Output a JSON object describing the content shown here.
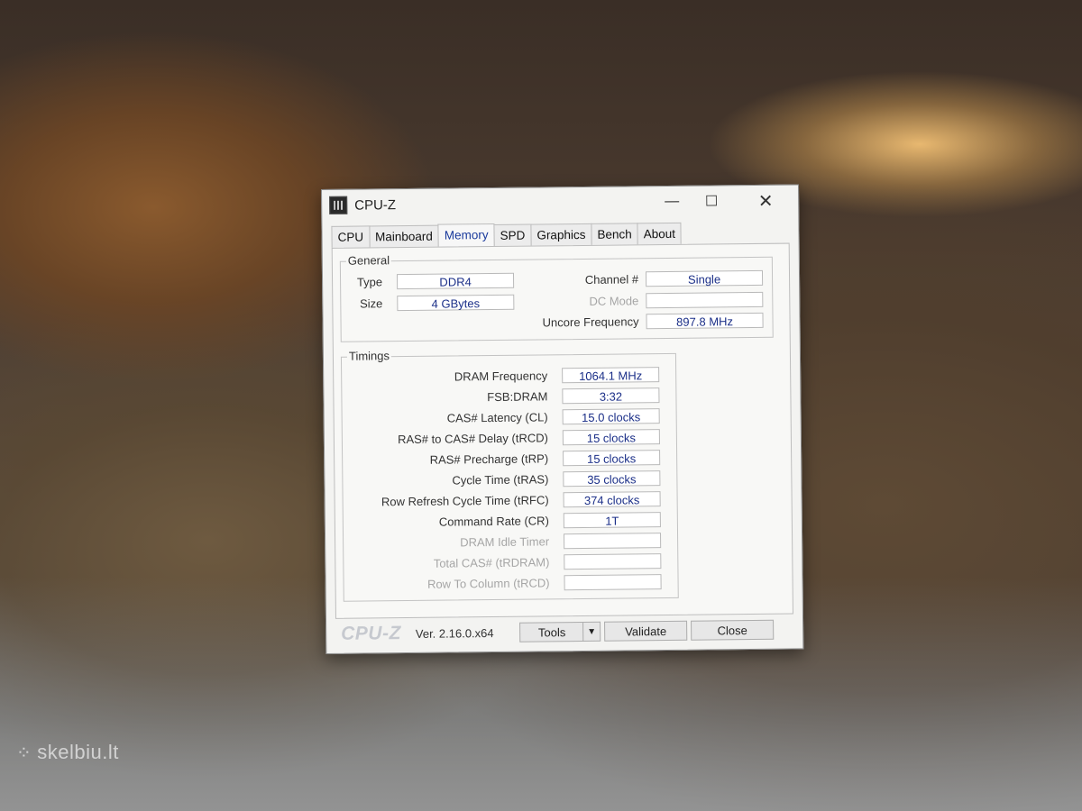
{
  "window": {
    "title": "CPU-Z"
  },
  "tabs": [
    {
      "label": "CPU",
      "active": false
    },
    {
      "label": "Mainboard",
      "active": false
    },
    {
      "label": "Memory",
      "active": true
    },
    {
      "label": "SPD",
      "active": false
    },
    {
      "label": "Graphics",
      "active": false
    },
    {
      "label": "Bench",
      "active": false
    },
    {
      "label": "About",
      "active": false
    }
  ],
  "general": {
    "title": "General",
    "type_label": "Type",
    "type_value": "DDR4",
    "size_label": "Size",
    "size_value": "4 GBytes",
    "channel_label": "Channel #",
    "channel_value": "Single",
    "dc_mode_label": "DC Mode",
    "dc_mode_value": "",
    "uncore_label": "Uncore Frequency",
    "uncore_value": "897.8 MHz"
  },
  "timings": {
    "title": "Timings",
    "rows": [
      {
        "label": "DRAM Frequency",
        "value": "1064.1 MHz",
        "dim": false
      },
      {
        "label": "FSB:DRAM",
        "value": "3:32",
        "dim": false
      },
      {
        "label": "CAS# Latency (CL)",
        "value": "15.0 clocks",
        "dim": false
      },
      {
        "label": "RAS# to CAS# Delay (tRCD)",
        "value": "15 clocks",
        "dim": false
      },
      {
        "label": "RAS# Precharge (tRP)",
        "value": "15 clocks",
        "dim": false
      },
      {
        "label": "Cycle Time (tRAS)",
        "value": "35 clocks",
        "dim": false
      },
      {
        "label": "Row Refresh Cycle Time (tRFC)",
        "value": "374 clocks",
        "dim": false
      },
      {
        "label": "Command Rate (CR)",
        "value": "1T",
        "dim": false
      },
      {
        "label": "DRAM Idle Timer",
        "value": "",
        "dim": true
      },
      {
        "label": "Total CAS# (tRDRAM)",
        "value": "",
        "dim": true
      },
      {
        "label": "Row To Column (tRCD)",
        "value": "",
        "dim": true
      }
    ]
  },
  "footer": {
    "brand": "CPU-Z",
    "version": "Ver. 2.16.0.x64",
    "tools_label": "Tools",
    "validate_label": "Validate",
    "close_label": "Close"
  },
  "watermark": {
    "text": "skelbiu.lt"
  }
}
